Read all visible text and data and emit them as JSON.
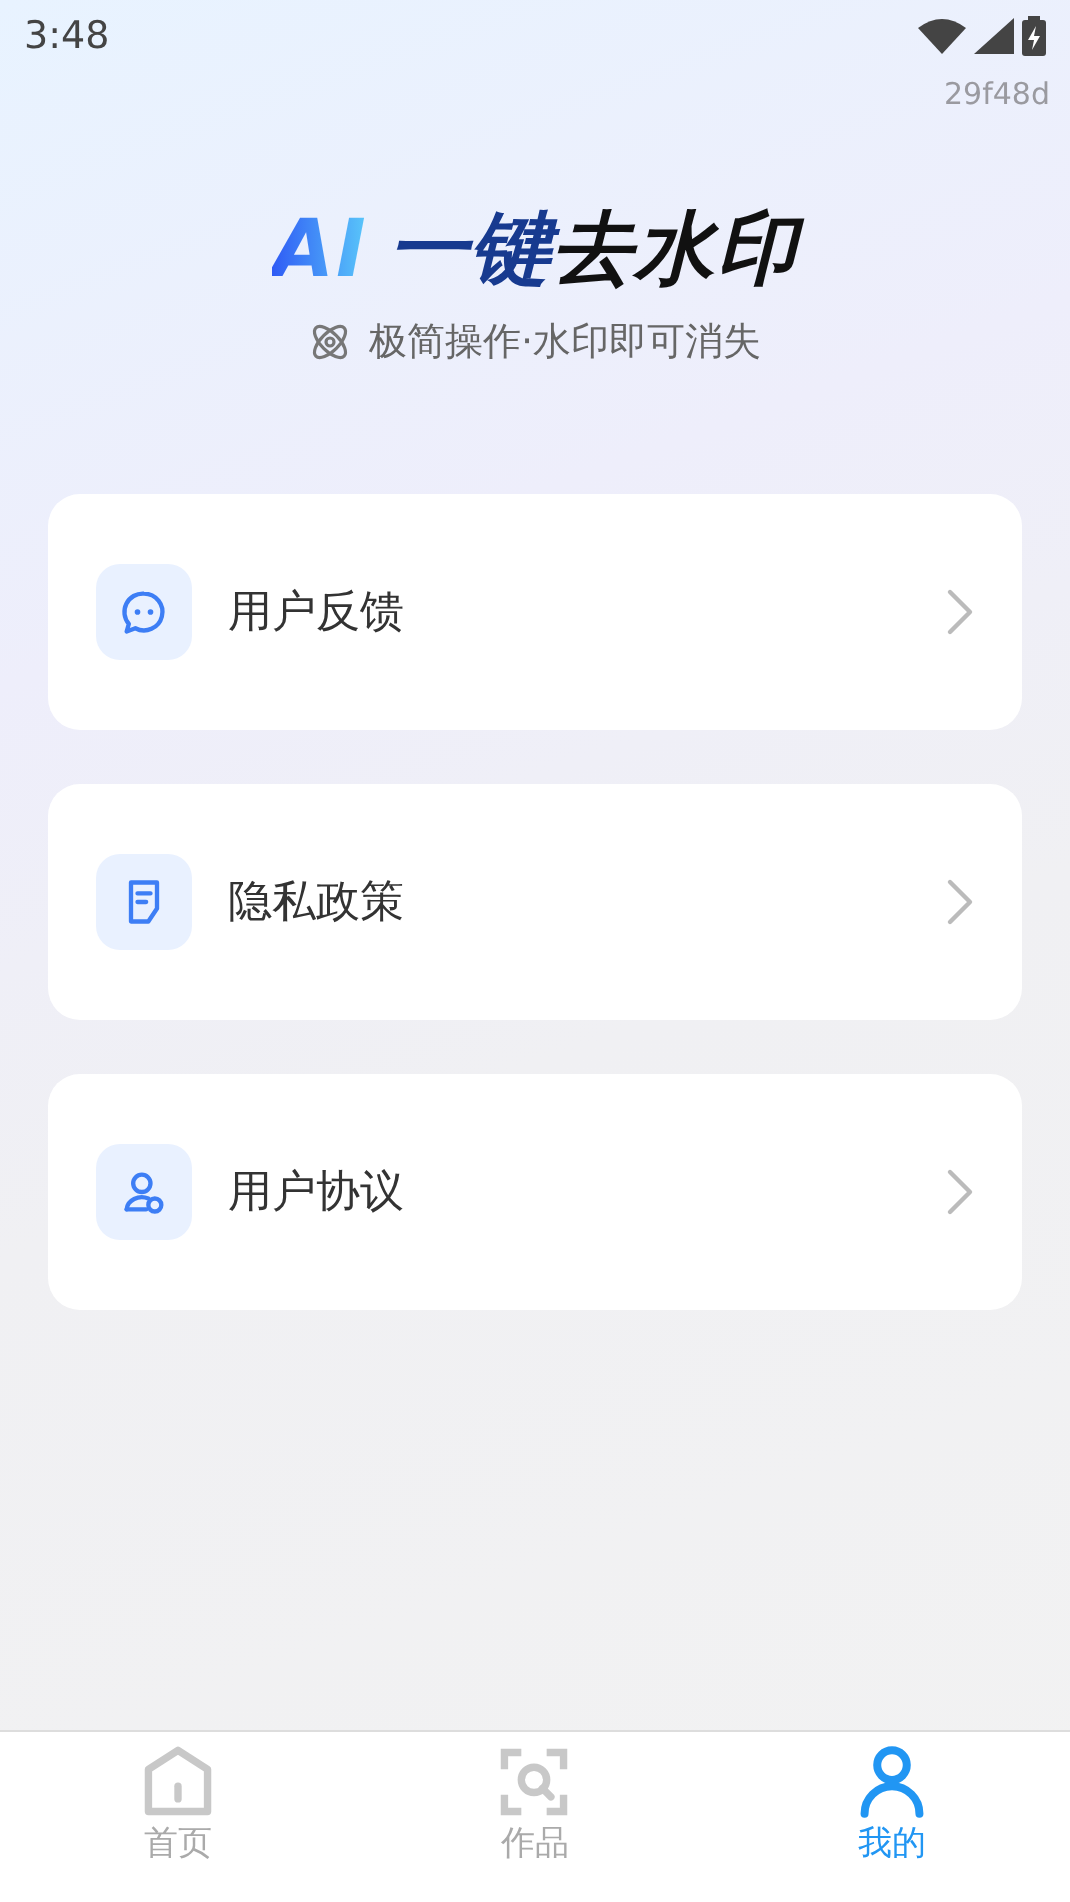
{
  "status_bar": {
    "time": "3:48"
  },
  "version": "29f48d",
  "title_parts": [
    {
      "text": "AI",
      "kind": "gradient"
    },
    {
      "text": "一键",
      "kind": "dark"
    },
    {
      "text": "去水印",
      "kind": "black"
    }
  ],
  "subtitle": "极简操作·水印即可消失",
  "menu": [
    {
      "label": "用户反馈",
      "kind": "chat"
    },
    {
      "label": "隐私政策",
      "kind": "document"
    },
    {
      "label": "用户协议",
      "kind": "user"
    }
  ],
  "tabs": [
    {
      "label": "首页",
      "kind": "home",
      "selected": false
    },
    {
      "label": "作品",
      "kind": "scan",
      "selected": false
    },
    {
      "label": "我的",
      "kind": "person",
      "selected": true
    }
  ]
}
